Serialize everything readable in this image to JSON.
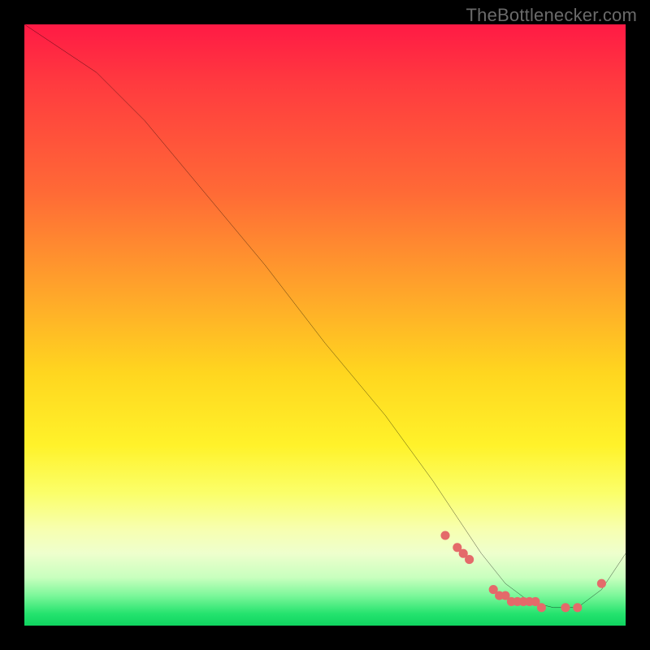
{
  "attribution": "TheBottlenecker.com",
  "chart_data": {
    "type": "line",
    "title": "",
    "xlabel": "",
    "ylabel": "",
    "xlim": [
      0,
      100
    ],
    "ylim": [
      0,
      100
    ],
    "series": [
      {
        "name": "curve",
        "x": [
          0,
          6,
          12,
          20,
          30,
          40,
          50,
          60,
          68,
          72,
          76,
          80,
          84,
          88,
          92,
          96,
          100
        ],
        "y": [
          100,
          96,
          92,
          84,
          72,
          60,
          47,
          35,
          24,
          18,
          12,
          7,
          4,
          3,
          3,
          6,
          12
        ]
      }
    ],
    "markers": {
      "name": "points",
      "color": "#e46a6a",
      "x": [
        70,
        72,
        73,
        74,
        78,
        79,
        80,
        81,
        82,
        83,
        84,
        85,
        86,
        90,
        92,
        96
      ],
      "y": [
        15,
        13,
        12,
        11,
        6,
        5,
        5,
        4,
        4,
        4,
        4,
        4,
        3,
        3,
        3,
        7
      ]
    },
    "gradient_stops": [
      {
        "pos": 0,
        "color": "#ff1a45"
      },
      {
        "pos": 28,
        "color": "#ff6a36"
      },
      {
        "pos": 58,
        "color": "#ffd61f"
      },
      {
        "pos": 84,
        "color": "#f7ffb0"
      },
      {
        "pos": 100,
        "color": "#0fd460"
      }
    ]
  }
}
